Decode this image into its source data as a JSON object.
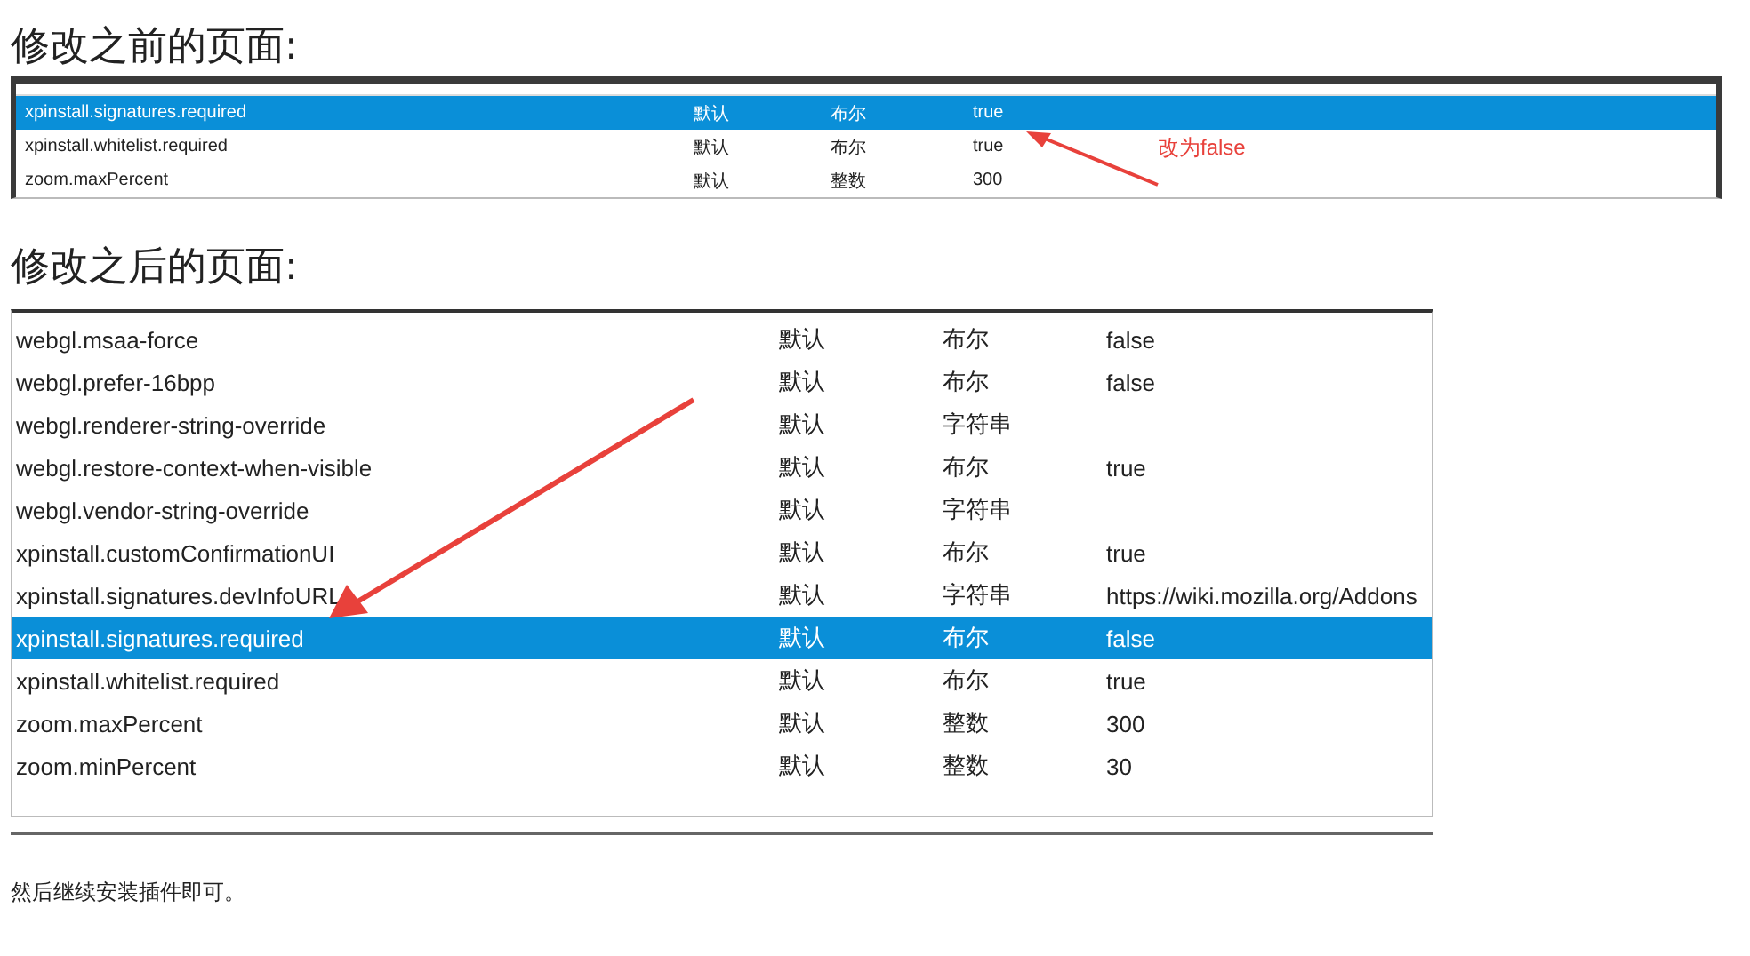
{
  "before": {
    "heading": "修改之前的页面:",
    "rows": [
      {
        "name": "xpinstall.signatures.required",
        "status": "默认",
        "type": "布尔",
        "value": "true",
        "selected": true
      },
      {
        "name": "xpinstall.whitelist.required",
        "status": "默认",
        "type": "布尔",
        "value": "true",
        "selected": false
      },
      {
        "name": "zoom.maxPercent",
        "status": "默认",
        "type": "整数",
        "value": "300",
        "selected": false
      }
    ],
    "annotation": "改为false"
  },
  "after": {
    "heading": "修改之后的页面:",
    "rows": [
      {
        "name": "webgl.msaa-force",
        "status": "默认",
        "type": "布尔",
        "value": "false",
        "selected": false
      },
      {
        "name": "webgl.prefer-16bpp",
        "status": "默认",
        "type": "布尔",
        "value": "false",
        "selected": false
      },
      {
        "name": "webgl.renderer-string-override",
        "status": "默认",
        "type": "字符串",
        "value": "",
        "selected": false
      },
      {
        "name": "webgl.restore-context-when-visible",
        "status": "默认",
        "type": "布尔",
        "value": "true",
        "selected": false
      },
      {
        "name": "webgl.vendor-string-override",
        "status": "默认",
        "type": "字符串",
        "value": "",
        "selected": false
      },
      {
        "name": "xpinstall.customConfirmationUI",
        "status": "默认",
        "type": "布尔",
        "value": "true",
        "selected": false
      },
      {
        "name": "xpinstall.signatures.devInfoURL",
        "status": "默认",
        "type": "字符串",
        "value": "https://wiki.mozilla.org/Addons",
        "selected": false
      },
      {
        "name": "xpinstall.signatures.required",
        "status": "默认",
        "type": "布尔",
        "value": "false",
        "selected": true
      },
      {
        "name": "xpinstall.whitelist.required",
        "status": "默认",
        "type": "布尔",
        "value": "true",
        "selected": false
      },
      {
        "name": "zoom.maxPercent",
        "status": "默认",
        "type": "整数",
        "value": "300",
        "selected": false
      },
      {
        "name": "zoom.minPercent",
        "status": "默认",
        "type": "整数",
        "value": "30",
        "selected": false
      }
    ]
  },
  "footer": "然后继续安装插件即可。"
}
